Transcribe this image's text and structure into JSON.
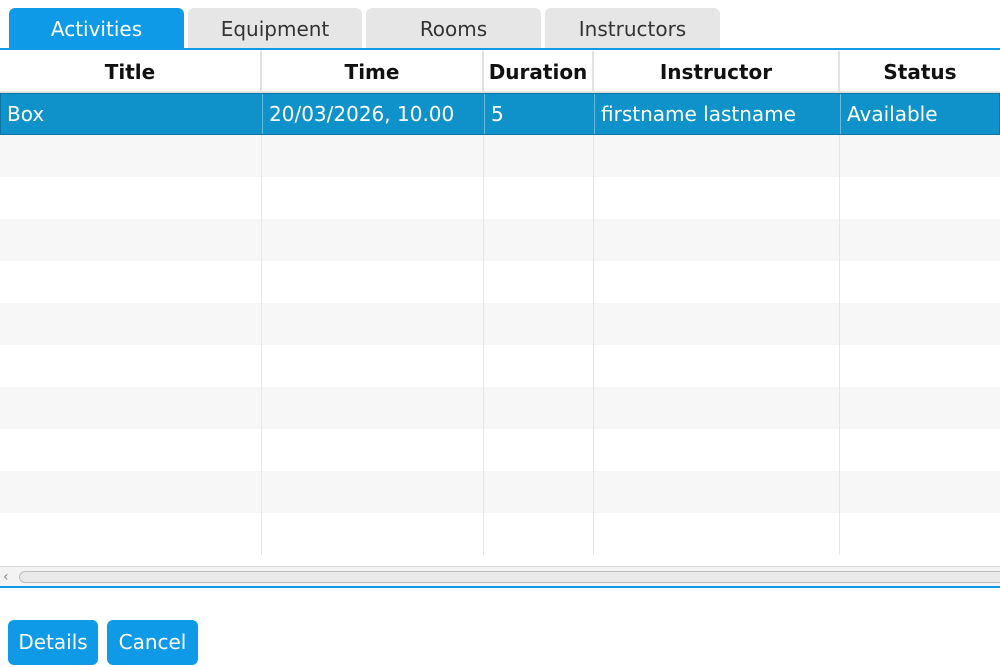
{
  "tabs": [
    {
      "label": "Activities",
      "active": true
    },
    {
      "label": "Equipment",
      "active": false
    },
    {
      "label": "Rooms",
      "active": false
    },
    {
      "label": "Instructors",
      "active": false
    }
  ],
  "table": {
    "headers": [
      "Title",
      "Time",
      "Duration",
      "Instructor",
      "Status"
    ],
    "rows": [
      {
        "title": "Box",
        "time": "20/03/2026, 10.00",
        "duration": "5",
        "instructor": "firstname lastname",
        "status": "Available",
        "selected": true
      }
    ]
  },
  "scrollbar": {
    "left_arrow": "‹"
  },
  "buttons": {
    "details_label": "Details",
    "cancel_label": "Cancel"
  },
  "colors": {
    "accent": "#0f9ae8",
    "selected_row": "#0f92c9"
  }
}
